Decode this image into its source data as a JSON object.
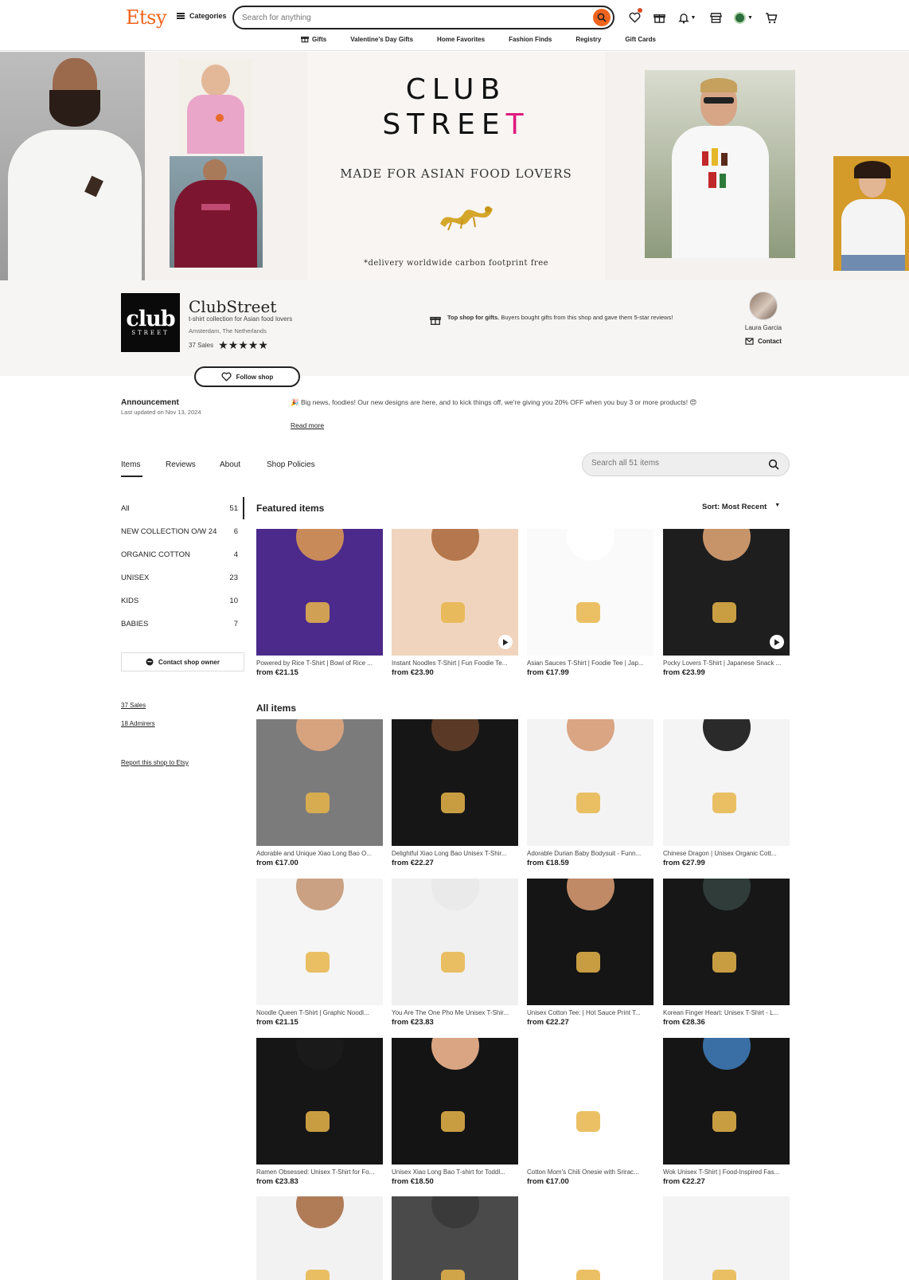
{
  "header": {
    "logo": "Etsy",
    "categories_label": "Categories",
    "search_placeholder": "Search for anything",
    "subnav": [
      "Gifts",
      "Valentine's Day Gifts",
      "Home Favorites",
      "Fashion Finds",
      "Registry",
      "Gift Cards"
    ]
  },
  "banner": {
    "title_line1": "CLUB",
    "title_line2_main": "STREE",
    "title_line2_accent": "T",
    "subtitle": "MADE FOR ASIAN FOOD LOVERS",
    "footer": "*delivery worldwide carbon footprint free"
  },
  "shop": {
    "logo_big": "club",
    "logo_small": "STREET",
    "name": "ClubStreet",
    "tagline": "t-shirt collection for Asian food lovers",
    "location": "Amsterdam, The Netherlands",
    "sales": "37 Sales",
    "stars": "★★★★★",
    "top_shop_bold": "Top shop for gifts.",
    "top_shop_text": " Buyers bought gifts from this shop and gave them 5-star reviews!",
    "owner_name": "Laura Garcia",
    "contact_label": "Contact",
    "follow_label": "Follow shop"
  },
  "announcement": {
    "title": "Announcement",
    "date": "Last updated on Nov 13, 2024",
    "text": "🎉 Big news, foodies! Our new designs are here, and to kick things off, we're giving you 20% OFF when you buy 3 or more products! 😍",
    "read_more": "Read more"
  },
  "tabs": [
    "Items",
    "Reviews",
    "About",
    "Shop Policies"
  ],
  "shop_search_placeholder": "Search all 51 items",
  "sidebar": {
    "categories": [
      {
        "label": "All",
        "count": "51"
      },
      {
        "label": "NEW COLLECTION O/W 24",
        "count": "6"
      },
      {
        "label": "ORGANIC COTTON",
        "count": "4"
      },
      {
        "label": "UNISEX",
        "count": "23"
      },
      {
        "label": "KIDS",
        "count": "10"
      },
      {
        "label": "BABIES",
        "count": "7"
      }
    ],
    "contact_owner": "Contact shop owner",
    "sales_link": "37 Sales",
    "admirers_link": "18 Admirers",
    "report_link": "Report this shop to Etsy"
  },
  "featured": {
    "title": "Featured items",
    "sort": "Sort: Most Recent",
    "items": [
      {
        "title": "Powered by Rice T-Shirt | Bowl of Rice ...",
        "price": "from €21.15",
        "bg": "#4b2a8c",
        "skin": "#c98a5a"
      },
      {
        "title": "Instant Noodles T-Shirt | Fun Foodie Te...",
        "price": "from €23.90",
        "bg": "#f1d4bd",
        "skin": "#b5774d"
      },
      {
        "title": "Asian Sauces T-Shirt | Foodie Tee | Jap...",
        "price": "from €17.99",
        "bg": "#fafafa",
        "skin": "#ffffff"
      },
      {
        "title": "Pocky Lovers T-Shirt | Japanese Snack ...",
        "price": "from €23.99",
        "bg": "#1e1e1e",
        "skin": "#c7946a"
      }
    ]
  },
  "all_items": {
    "title": "All items",
    "items": [
      {
        "title": "Adorable and Unique Xiao Long Bao O...",
        "price": "from €17.00",
        "bg": "#7b7b7b",
        "top": "#d7a27e"
      },
      {
        "title": "Delightful Xiao Long Bao Unisex T-Shir...",
        "price": "from €22.27",
        "bg": "#161616",
        "top": "#5a3a26"
      },
      {
        "title": "Adorable Durian Baby Bodysuit - Funn...",
        "price": "from €18.59",
        "bg": "#f3f3f3",
        "top": "#d9a583"
      },
      {
        "title": "Chinese Dragon | Unisex Organic Cott...",
        "price": "from €27.99",
        "bg": "#f4f4f4",
        "top": "#2a2a2a"
      },
      {
        "title": "Noodle Queen T-Shirt | Graphic Noodl...",
        "price": "from €21.15",
        "bg": "#f5f5f5",
        "top": "#caa182"
      },
      {
        "title": "You Are The One Pho Me Unisex T-Shir...",
        "price": "from €23.83",
        "bg": "#f0f0f0",
        "top": "#eaeaea"
      },
      {
        "title": "Unisex Cotton Tee: | Hot Sauce Print T...",
        "price": "from €22.27",
        "bg": "#151515",
        "top": "#c08a67"
      },
      {
        "title": "Korean Finger Heart: Unisex T-Shirt - L...",
        "price": "from €28.36",
        "bg": "#171717",
        "top": "#2f3c3a"
      },
      {
        "title": "Ramen Obsessed: Unisex T-Shirt for Fo...",
        "price": "from €23.83",
        "bg": "#161616",
        "top": "#1a1a1a"
      },
      {
        "title": "Unisex Xiao Long Bao T-shirt for Toddl...",
        "price": "from €18.50",
        "bg": "#141414",
        "top": "#d9a583"
      },
      {
        "title": "Cotton Mom's Chili Onesie with Srirac...",
        "price": "from €17.00",
        "bg": "#ffffff",
        "top": "#ffffff"
      },
      {
        "title": "Wok Unisex T-Shirt | Food-Inspired Fas...",
        "price": "from €22.27",
        "bg": "#151515",
        "top": "#3a6fa5"
      },
      {
        "title": "",
        "price": "",
        "bg": "#f2f2f2",
        "top": "#b07c58"
      },
      {
        "title": "",
        "price": "",
        "bg": "#4a4a4a",
        "top": "#3a3a3a"
      },
      {
        "title": "",
        "price": "",
        "bg": "#ffffff",
        "top": "#ffffff"
      },
      {
        "title": "",
        "price": "",
        "bg": "#f3f3f3",
        "top": "#f3f3f3"
      }
    ]
  },
  "colors": {
    "accent": "#f1641e",
    "brand_pink": "#e0197d"
  }
}
